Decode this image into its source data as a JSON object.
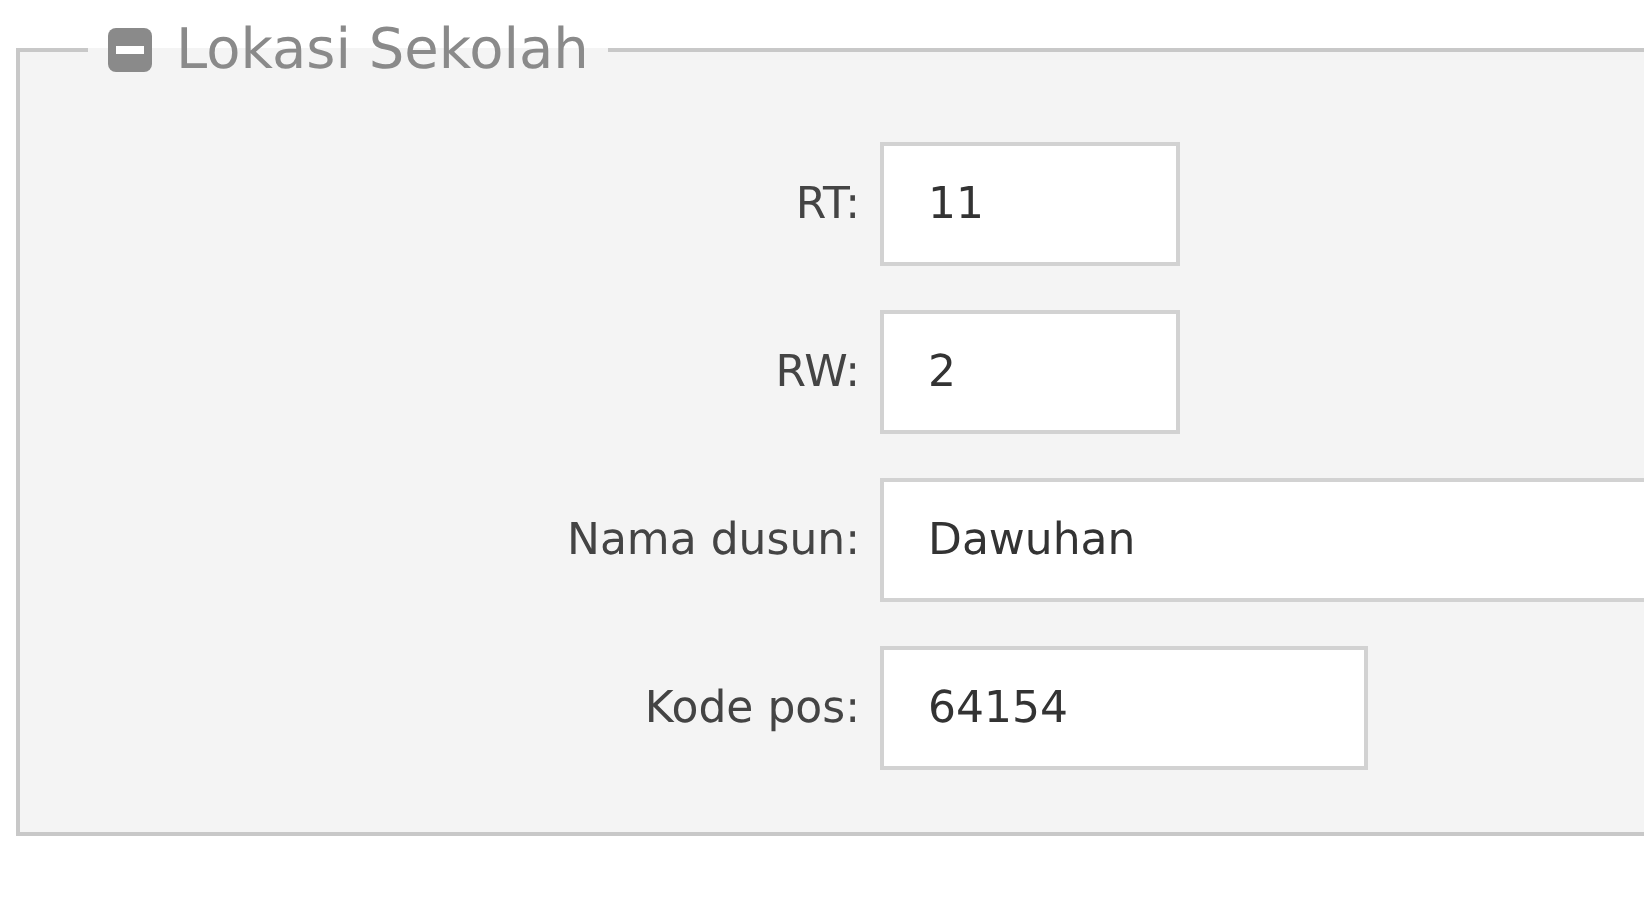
{
  "section": {
    "title": "Lokasi Sekolah",
    "expanded": true
  },
  "fields": [
    {
      "label": "RT:",
      "value": "11",
      "kind": "short"
    },
    {
      "label": "RW:",
      "value": "2",
      "kind": "short"
    },
    {
      "label": "Nama dusun:",
      "value": "Dawuhan",
      "kind": "wide"
    },
    {
      "label": "Kode pos:",
      "value": "64154",
      "kind": "medium"
    }
  ]
}
